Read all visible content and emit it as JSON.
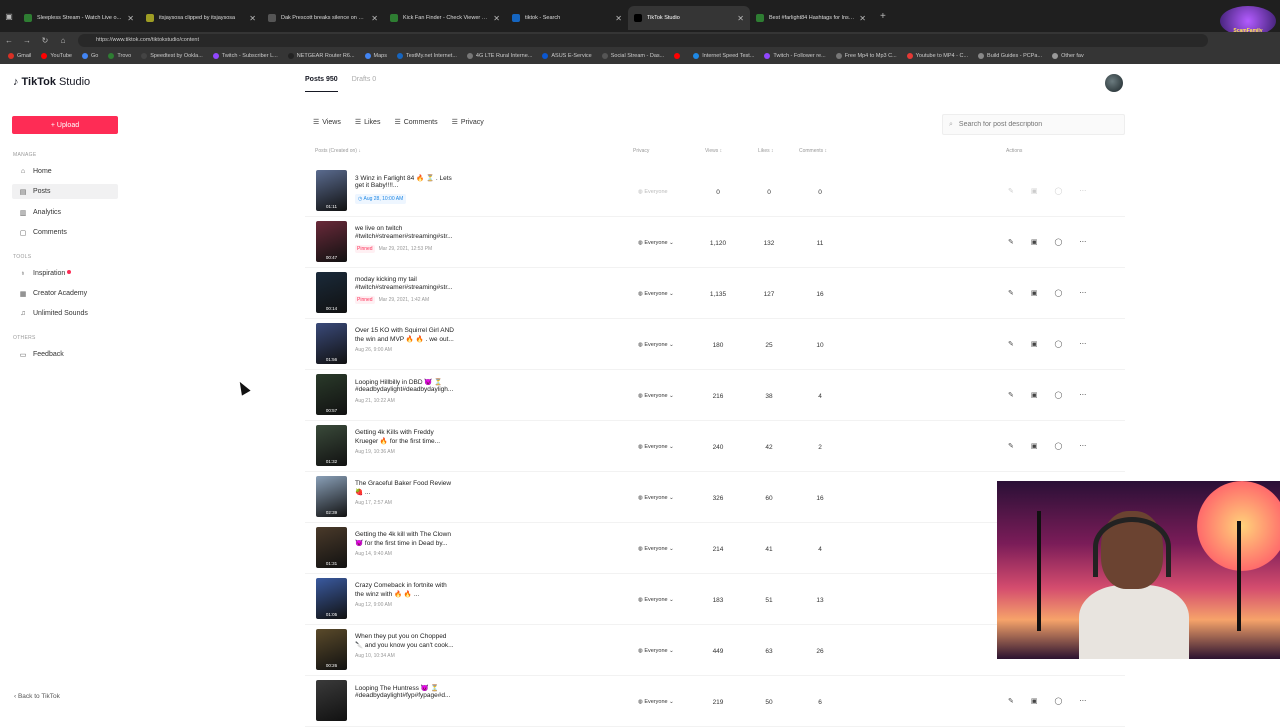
{
  "browser": {
    "tabs": [
      {
        "title": "Sleepless Stream - Watch Live o...",
        "color": "#2e7d32"
      },
      {
        "title": "itsjaysosa clipped by itsjaysosa",
        "color": "#9e9d24"
      },
      {
        "title": "Dak Prescott breaks silence on w...",
        "color": "#555555"
      },
      {
        "title": "Kick Fan Finder - Check Viewer St...",
        "color": "#2e7d32"
      },
      {
        "title": "tiktok - Search",
        "color": "#1565c0"
      },
      {
        "title": "TikTok Studio",
        "color": "#000000"
      },
      {
        "title": "Best #farlight84 Hashtags for Inst...",
        "color": "#2e7d32"
      }
    ],
    "url": "https://www.tiktok.com/tiktokstudio/content",
    "bookmarks": [
      "Gmail",
      "YouTube",
      "Go",
      "Trovo",
      "Speedtest by Ookla...",
      "Twitch - Subscriber L...",
      "NETGEAR Router R6...",
      "Maps",
      "TestMy.net Internet...",
      "4G LTE Rural Interne...",
      "ASUS E-Service",
      "Social Stream - Das...",
      "",
      "Internet Speed Test...",
      "Twitch - Follower re...",
      "Free Mp4 to Mp3 C...",
      "Youtube to MP4 - C...",
      "Build Guides - PCPa...",
      "Other fav"
    ],
    "streamer_logo": "ScamFamily"
  },
  "sidebar": {
    "logo_brand": "TikTok",
    "logo_product": "Studio",
    "upload_label": "+ Upload",
    "section_manage": "MANAGE",
    "section_tools": "TOOLS",
    "section_others": "OTHERS",
    "items": {
      "home": "Home",
      "posts": "Posts",
      "analytics": "Analytics",
      "comments": "Comments",
      "inspiration": "Inspiration",
      "creator_academy": "Creator Academy",
      "unlimited_sounds": "Unlimited Sounds",
      "feedback": "Feedback"
    },
    "back_link": "‹ Back to TikTok"
  },
  "main": {
    "tab_posts": "Posts 950",
    "tab_drafts": "Drafts 0",
    "filters": {
      "views": "Views",
      "likes": "Likes",
      "comments": "Comments",
      "privacy": "Privacy"
    },
    "search_placeholder": "Search for post description",
    "headers": {
      "posts": "Posts (Created on) ↓",
      "privacy": "Privacy",
      "views": "Views ↕",
      "likes": "Likes ↕",
      "comments": "Comments ↕",
      "actions": "Actions"
    }
  },
  "posts": [
    {
      "line1": "3 Winz in Farlight 84 🔥 ⏳ . Lets",
      "line2": "get it Baby!!!!...",
      "badge": "",
      "date": "Aug 28, 10:00 AM",
      "scheduled": true,
      "duration": "01:11",
      "privacy": "Everyone",
      "views": "0",
      "likes": "0",
      "comments": "0",
      "color": "#5a6b8f"
    },
    {
      "line1": "we live on twitch",
      "line2": "#twitch#streamer#streaming#str...",
      "badge": "Pinned",
      "date": "Mar 29, 2021, 12:53 PM",
      "scheduled": false,
      "duration": "00:47",
      "privacy": "Everyone",
      "views": "1,120",
      "likes": "132",
      "comments": "11",
      "color": "#6a2a3a"
    },
    {
      "line1": "moday kicking my tail",
      "line2": "#twitch#streamer#streaming#str...",
      "badge": "Pinned",
      "date": "Mar 29, 2021, 1:42 AM",
      "scheduled": false,
      "duration": "00:14",
      "privacy": "Everyone",
      "views": "1,135",
      "likes": "127",
      "comments": "16",
      "color": "#1a2a3a"
    },
    {
      "line1": "Over 15 KO with Squirrel Girl AND",
      "line2": "the win and MVP 🔥 🔥 . we out...",
      "badge": "",
      "date": "Aug 26, 9:00 AM",
      "scheduled": false,
      "duration": "01:56",
      "privacy": "Everyone",
      "views": "180",
      "likes": "25",
      "comments": "10",
      "color": "#3a4a7a"
    },
    {
      "line1": "Looping Hillbilly in DBD 😈 ⏳",
      "line2": "#deadbydaylight#deadbydayligh...",
      "badge": "",
      "date": "Aug 21, 10:22 AM",
      "scheduled": false,
      "duration": "00:57",
      "privacy": "Everyone",
      "views": "216",
      "likes": "38",
      "comments": "4",
      "color": "#2a3a2a"
    },
    {
      "line1": "Getting 4k Kills with Freddy",
      "line2": "Krueger 🔥 for the first time...",
      "badge": "",
      "date": "Aug 19, 10:36 AM",
      "scheduled": false,
      "duration": "01:32",
      "privacy": "Everyone",
      "views": "240",
      "likes": "42",
      "comments": "2",
      "color": "#3a4a3a"
    },
    {
      "line1": "The Graceful Baker Food Review",
      "line2": "🍓 ...",
      "badge": "",
      "date": "Aug 17, 2:57 AM",
      "scheduled": false,
      "duration": "02:39",
      "privacy": "Everyone",
      "views": "326",
      "likes": "60",
      "comments": "16",
      "color": "#8aa0b8"
    },
    {
      "line1": "Getting the 4k kill with The Clown",
      "line2": "😈 for the first time in Dead by...",
      "badge": "",
      "date": "Aug 14, 9:40 AM",
      "scheduled": false,
      "duration": "01:31",
      "privacy": "Everyone",
      "views": "214",
      "likes": "41",
      "comments": "4",
      "color": "#4a3a2a"
    },
    {
      "line1": "Crazy Comeback in fortnite with",
      "line2": "the winz with 🔥 🔥 ...",
      "badge": "",
      "date": "Aug 12, 9:00 AM",
      "scheduled": false,
      "duration": "01:05",
      "privacy": "Everyone",
      "views": "183",
      "likes": "51",
      "comments": "13",
      "color": "#3a5aa0"
    },
    {
      "line1": "When they put you on Chopped",
      "line2": "🔪 and you know you can't cook...",
      "badge": "",
      "date": "Aug 10, 10:34 AM",
      "scheduled": false,
      "duration": "00:26",
      "privacy": "Everyone",
      "views": "449",
      "likes": "63",
      "comments": "26",
      "color": "#5a4a2a"
    },
    {
      "line1": "Looping The Huntress 😈 ⏳",
      "line2": "#deadbydaylight#fyp#fypage#d...",
      "badge": "",
      "date": "",
      "scheduled": false,
      "duration": "",
      "privacy": "Everyone",
      "views": "219",
      "likes": "50",
      "comments": "6",
      "color": "#3a3a3a"
    }
  ]
}
